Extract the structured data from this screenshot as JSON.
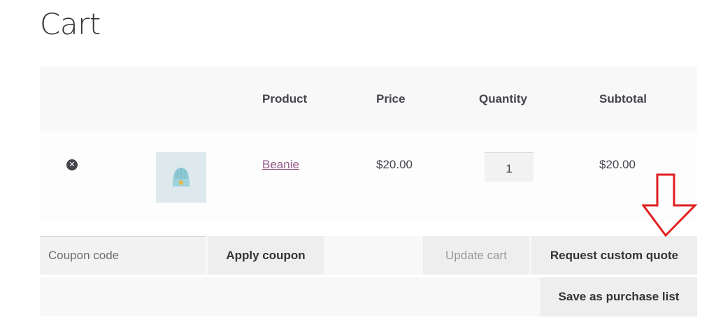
{
  "page": {
    "title": "Cart"
  },
  "table": {
    "headers": {
      "product": "Product",
      "price": "Price",
      "quantity": "Quantity",
      "subtotal": "Subtotal"
    },
    "items": [
      {
        "remove_icon": "close-circle-icon",
        "image_icon": "beanie-hat-icon",
        "name": "Beanie",
        "price": "$20.00",
        "quantity": "1",
        "subtotal": "$20.00"
      }
    ]
  },
  "actions": {
    "coupon_placeholder": "Coupon code",
    "apply_coupon": "Apply coupon",
    "update_cart": "Update cart",
    "request_quote": "Request custom quote",
    "save_purchase_list": "Save as purchase list"
  },
  "annotation": {
    "arrow_icon": "down-arrow-icon",
    "arrow_color": "#e02020"
  },
  "colors": {
    "link": "#96588a",
    "header_bg": "#f8f8f8",
    "button_bg": "#eeeeee"
  }
}
